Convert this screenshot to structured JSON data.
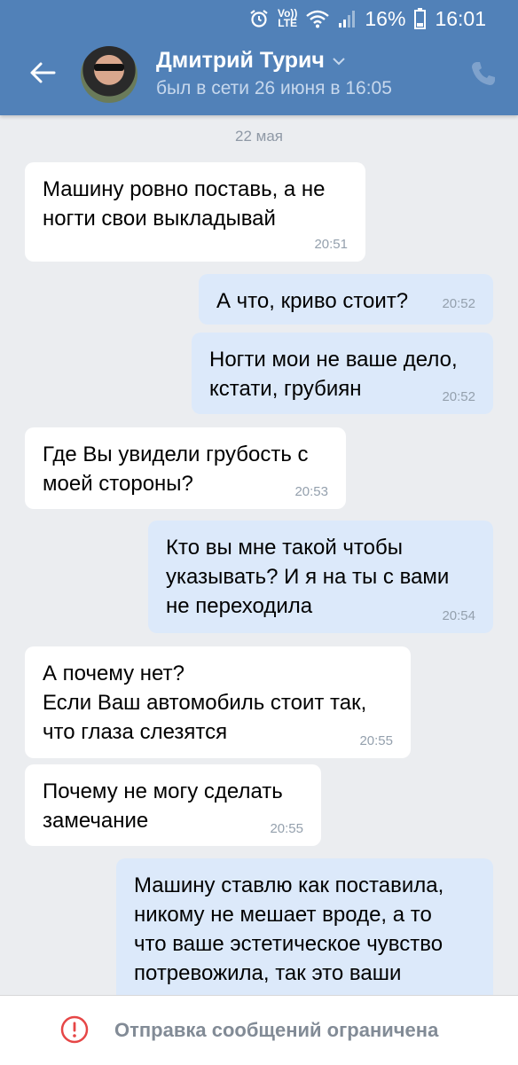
{
  "status_bar": {
    "network_top": "Vo))",
    "network_bottom": "LTE",
    "battery": "16%",
    "time": "16:01",
    "icons": [
      "alarm-icon",
      "volte-icon",
      "wifi-icon",
      "signal-icon",
      "battery-icon"
    ]
  },
  "header": {
    "contact_name": "Дмитрий Турич",
    "contact_status": "был в сети 26 июня в 16:05",
    "back_icon": "arrow-left-icon",
    "call_icon": "phone-icon",
    "dropdown_icon": "chevron-down-icon"
  },
  "chat": {
    "date_separator": "22 мая",
    "messages": [
      {
        "text": "Машину ровно поставь, а не\nногти свои выкладывай",
        "time": "20:51",
        "direction": "in"
      },
      {
        "text": "А что, криво стоит?",
        "time": "20:52",
        "direction": "out"
      },
      {
        "text": "Ногти мои не ваше дело,\nкстати, грубиян",
        "time": "20:52",
        "direction": "out"
      },
      {
        "text": "Где Вы увидели грубость с\nмоей стороны?",
        "time": "20:53",
        "direction": "in"
      },
      {
        "text": "Кто вы мне такой чтобы\nуказывать? И я на ты с вами\nне переходила",
        "time": "20:54",
        "direction": "out"
      },
      {
        "text": "А почему нет?\nЕсли Ваш автомобиль стоит так,\nчто глаза слезятся",
        "time": "20:55",
        "direction": "in"
      },
      {
        "text": "Почему не могу сделать\nзамечание",
        "time": "20:55",
        "direction": "in"
      },
      {
        "text": "Машину ставлю как поставила,\nникому не мешает вроде,  а то\nчто ваше эстетическое чувство\nпотревожила,  так это ваши",
        "time": "",
        "direction": "out"
      }
    ]
  },
  "footer": {
    "restriction_text": "Отправка сообщений ограничена",
    "icon": "exclamation-circle-icon",
    "icon_color": "#e64646"
  },
  "colors": {
    "header_bg": "#5181b8",
    "chat_bg": "#ebedf0",
    "incoming_bubble": "#ffffff",
    "outgoing_bubble": "#dce9fa"
  }
}
